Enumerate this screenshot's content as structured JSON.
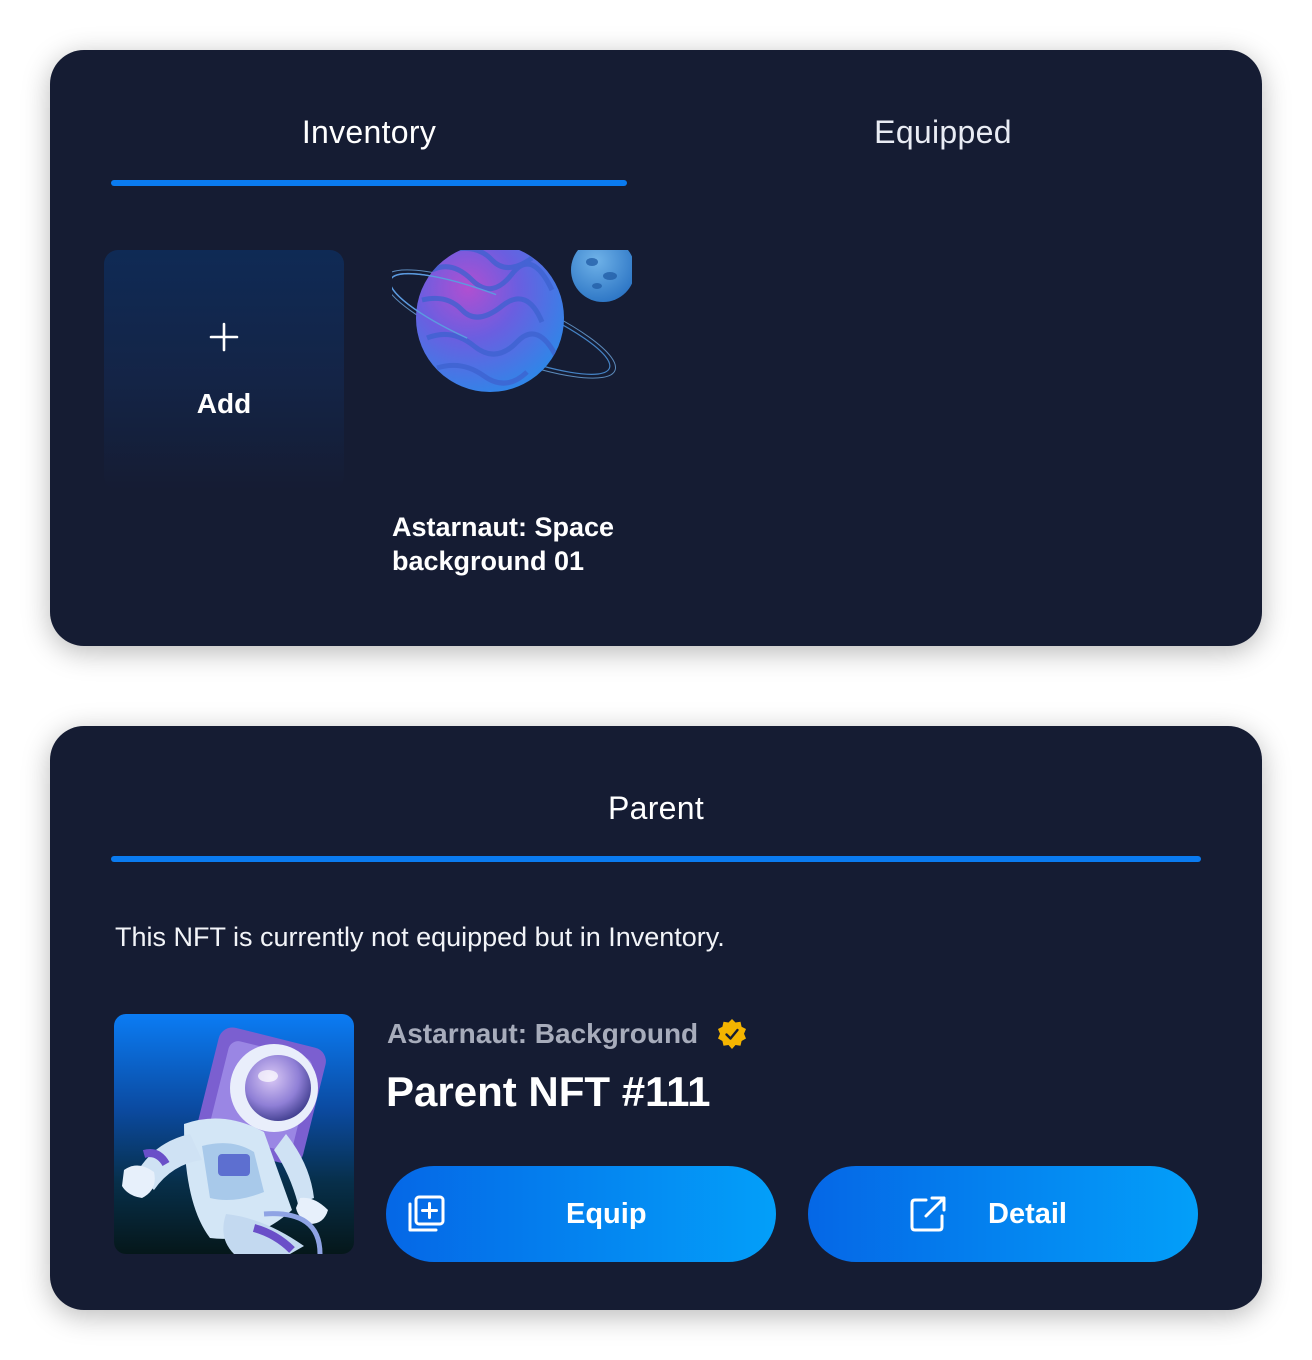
{
  "inventory_panel": {
    "tabs": [
      {
        "label": "Inventory",
        "active": true
      },
      {
        "label": "Equipped",
        "active": false
      }
    ],
    "add_card": {
      "label": "Add",
      "icon": "plus-icon"
    },
    "items": [
      {
        "title": "Astarnaut: Space background 01",
        "image": "planet-space-art"
      }
    ]
  },
  "parent_panel": {
    "tab_label": "Parent",
    "status_text": "This NFT is currently not equipped but in Inventory.",
    "nft": {
      "collection": "Astarnaut: Background",
      "verified_icon": "verified-badge-icon",
      "name": "Parent NFT #111",
      "image": "astronaut-art"
    },
    "buttons": {
      "equip_label": "Equip",
      "equip_icon": "add-to-collection-icon",
      "detail_label": "Detail",
      "detail_icon": "external-link-icon"
    }
  },
  "colors": {
    "panel_bg": "#151c33",
    "accent": "#0a7bf0",
    "button_gradient_start": "#0567e6",
    "button_gradient_end": "#039ff9",
    "verified_badge": "#f4b400",
    "muted_text": "#a7acbb"
  }
}
